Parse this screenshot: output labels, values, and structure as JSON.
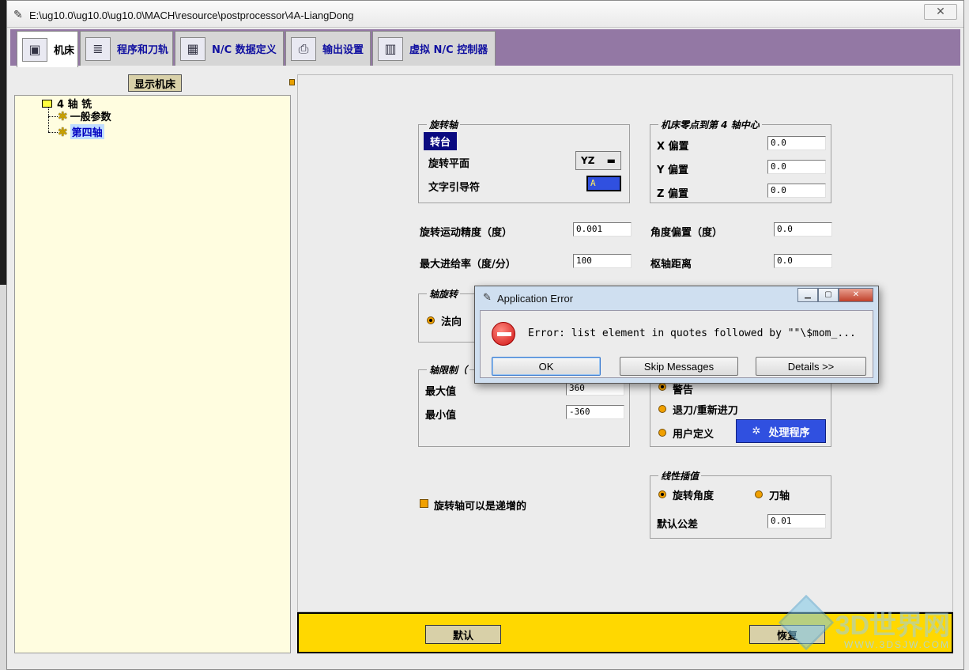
{
  "window": {
    "title": "E:\\ug10.0\\ug10.0\\ug10.0\\MACH\\resource\\postprocessor\\4A-LiangDong"
  },
  "tabs": [
    {
      "label": "机床",
      "icon": "machine-icon",
      "active": true
    },
    {
      "label": "程序和刀轨",
      "icon": "program-icon",
      "active": false
    },
    {
      "label": "N/C 数据定义",
      "icon": "nc-data-icon",
      "active": false
    },
    {
      "label": "输出设置",
      "icon": "printer-icon",
      "active": false
    },
    {
      "label": "虚拟 N/C 控制器",
      "icon": "controller-icon",
      "active": false
    }
  ],
  "left": {
    "show_button": "显示机床",
    "tree": {
      "root": "4 轴 铣",
      "children": [
        "一般参数",
        "第四轴"
      ],
      "selected": "第四轴"
    }
  },
  "rotary_axis": {
    "title": "旋转轴",
    "tag": "转台",
    "plane_label": "旋转平面",
    "plane_value": "YZ",
    "leader_label": "文字引导符",
    "leader_value": "A"
  },
  "zero_to_center": {
    "title": "机床零点到第 4 轴中心",
    "x_label": "X 偏置",
    "x_value": "0.0",
    "y_label": "Y 偏置",
    "y_value": "0.0",
    "z_label": "Z 偏置",
    "z_value": "0.0"
  },
  "motion": {
    "resolution_label": "旋转运动精度（度）",
    "resolution_value": "0.001",
    "angle_offset_label": "角度偏置（度）",
    "angle_offset_value": "0.0",
    "max_feed_label": "最大进给率（度/分）",
    "max_feed_value": "100",
    "pivot_label": "枢轴距离",
    "pivot_value": "0.0"
  },
  "axis_rotation": {
    "title": "轴旋转",
    "normal_label": "法向"
  },
  "axis_limits": {
    "title": "轴限制（",
    "max_label": "最大值",
    "max_value": "360",
    "min_label": "最小值",
    "min_value": "-360"
  },
  "limit_action": {
    "warning_label": "警告",
    "retract_label": "退刀/重新进刀",
    "user_label": "用户定义",
    "handler_button": "处理程序"
  },
  "incremental_label": "旋转轴可以是递增的",
  "linear_interp": {
    "title": "线性插值",
    "rotary_angle_label": "旋转角度",
    "tool_axis_label": "刀轴",
    "tolerance_label": "默认公差",
    "tolerance_value": "0.01"
  },
  "bottom": {
    "default_button": "默认",
    "restore_button": "恢复"
  },
  "watermark": {
    "text": "3D世界网",
    "sub": "WWW.3DSJW.COM"
  },
  "dialog": {
    "title": "Application Error",
    "message": "Error: list element in quotes followed by \"\"\\$mom_...",
    "ok": "OK",
    "skip": "Skip Messages",
    "details": "Details >>"
  }
}
